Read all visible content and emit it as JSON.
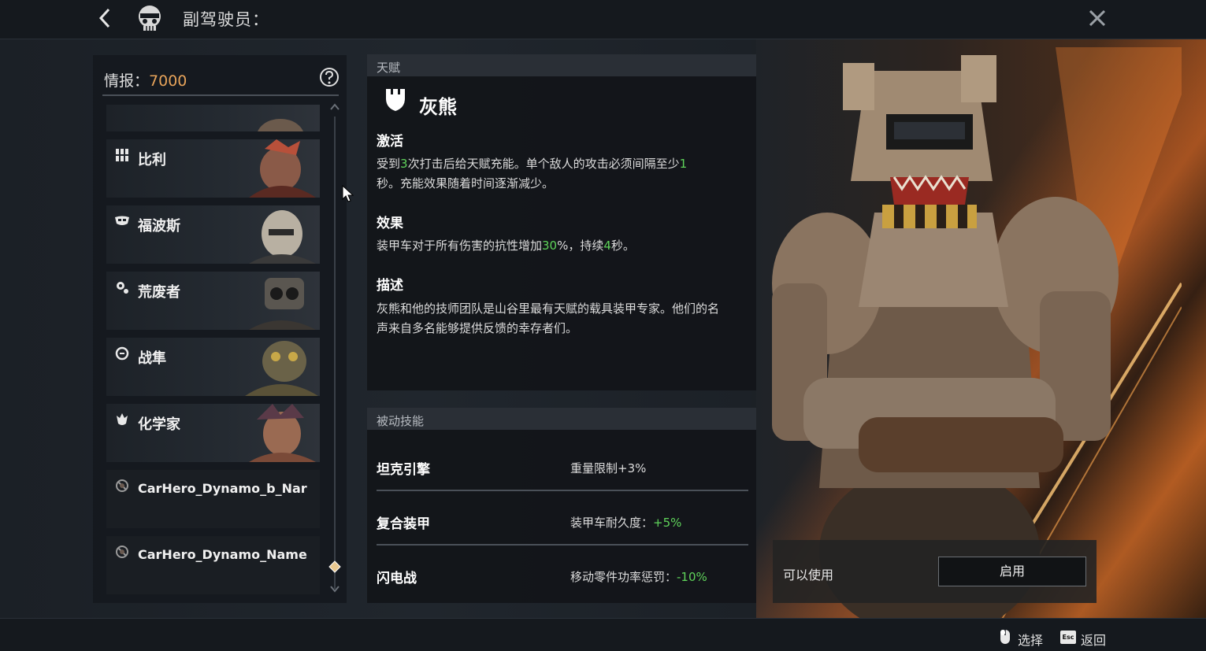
{
  "header": {
    "title": "副驾驶员："
  },
  "intel": {
    "label": "情报：",
    "value": "7000"
  },
  "copilots": [
    {
      "label": "比利",
      "icon": "grid-icon"
    },
    {
      "label": "福波斯",
      "icon": "mask-icon"
    },
    {
      "label": "荒废者",
      "icon": "gear-icon"
    },
    {
      "label": "战隼",
      "icon": "cycle-icon"
    },
    {
      "label": "化学家",
      "icon": "flame-icon"
    },
    {
      "label": "CarHero_Dynamo_b_Nar",
      "icon": "locked-icon"
    },
    {
      "label": "CarHero_Dynamo_Name",
      "icon": "locked-icon"
    }
  ],
  "talent": {
    "header": "天赋",
    "name": "灰熊",
    "activation_title": "激活",
    "activation_text_1": "受到",
    "activation_num_1": "3",
    "activation_text_2": "次打击后给天赋充能。单个敌人的攻击必须间隔至少",
    "activation_num_2": "1",
    "activation_text_3": "秒。充能效果随着时间逐渐减少。",
    "effect_title": "效果",
    "effect_text_1": "装甲车对于所有伤害的抗性增加",
    "effect_num_1": "30",
    "effect_text_2": "%，持续",
    "effect_num_2": "4",
    "effect_text_3": "秒。",
    "desc_title": "描述",
    "desc_text": "灰熊和他的技师团队是山谷里最有天赋的载具装甲专家。他们的名声来自多名能够提供反馈的幸存者们。"
  },
  "passives": {
    "header": "被动技能",
    "rows": [
      {
        "name": "坦克引擎",
        "value_prefix": "重量限制",
        "value_num": "+3%",
        "num_colored": false
      },
      {
        "name": "复合装甲",
        "value_prefix": "装甲车耐久度：",
        "value_num": "+5%",
        "num_colored": true
      },
      {
        "name": "闪电战",
        "value_prefix": "移动零件功率惩罚：",
        "value_num": "-10%",
        "num_colored": true
      }
    ]
  },
  "availability": {
    "status": "可以使用",
    "button": "启用"
  },
  "footer": {
    "select_label": "选择",
    "esc_key": "Esc",
    "back_label": "返回"
  },
  "colors": {
    "highlight_green": "#5fd35a",
    "intel_orange": "#e6a35a"
  }
}
